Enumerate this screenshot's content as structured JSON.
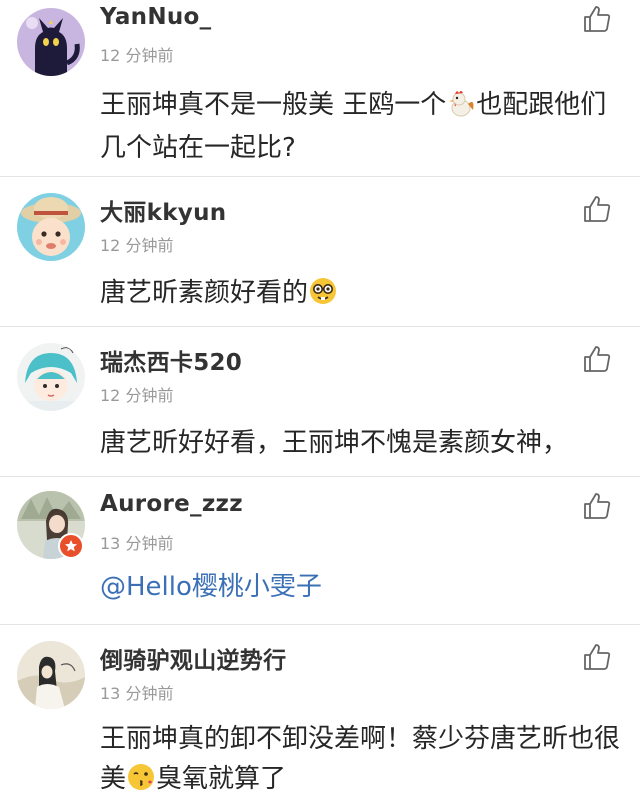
{
  "comments": [
    {
      "username": "YanNuo_",
      "time": "12 分钟前",
      "text_parts": [
        "王丽坤真不是一般美 王鸥一个",
        "也配跟他们几个站在一起比?"
      ],
      "emoji": "rooster",
      "avatar": "black-cat-avatar"
    },
    {
      "username": "大丽kkyun",
      "time": "12 分钟前",
      "text_parts": [
        "唐艺昕素颜好看的",
        ""
      ],
      "emoji": "nerd-face",
      "avatar": "baby-in-hat-avatar"
    },
    {
      "username": "瑞杰西卡520",
      "time": "12 分钟前",
      "text": "唐艺昕好好看，王丽坤不愧是素颜女神，",
      "avatar": "cartoon-girl-avatar"
    },
    {
      "username": "Aurore_zzz",
      "time": "13 分钟前",
      "text": "@Hello樱桃小雯子",
      "avatar": "girl-photo-avatar",
      "badge": "star-badge"
    },
    {
      "username": "倒骑驴观山逆势行",
      "time": "13 分钟前",
      "text_parts": [
        "王丽坤真的卸不卸没差啊！蔡少芬唐艺昕也很美",
        "臭氧就算了"
      ],
      "emoji": "kissing-face",
      "avatar": "ink-painting-avatar"
    }
  ],
  "colors": {
    "username": "#333333",
    "timestamp": "#999999",
    "text": "#262626",
    "mention": "#3c70b6",
    "divider": "#e4e4e4",
    "badge": "#e8502b"
  }
}
